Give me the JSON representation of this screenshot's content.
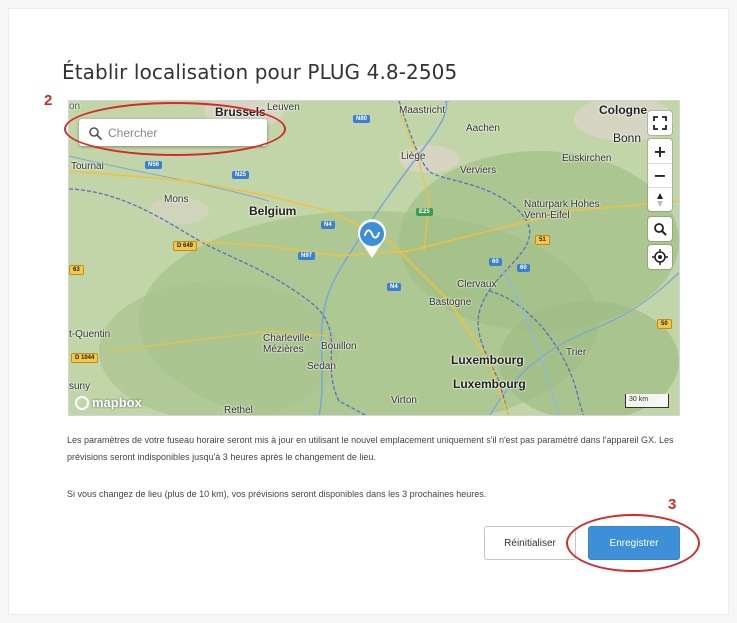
{
  "dialog": {
    "title": "Établir localisation pour PLUG 4.8-2505"
  },
  "map": {
    "search_placeholder": "Chercher",
    "controls": {
      "fullscreen": "fullscreen-icon",
      "zoom_in": "+",
      "zoom_out": "−",
      "compass": "compass-icon",
      "search": "search-zoom-icon",
      "locate": "locate-icon"
    },
    "labels": {
      "brussels": "Brussels",
      "leuven": "Leuven",
      "maastricht": "Maastricht",
      "aachen": "Aachen",
      "cologne": "Cologne",
      "bonn": "Bonn",
      "tournai": "Tournai",
      "liege": "Liège",
      "verviers": "Verviers",
      "euskirchen": "Euskirchen",
      "mons": "Mons",
      "belgium": "Belgium",
      "naturpark": "Naturpark Hohes\nVenn-Eifel",
      "bastogne": "Bastogne",
      "clervaux": "Clervaux",
      "st_quentin": "t-Quentin",
      "charleville": "Charleville-\nMézières",
      "bouillon": "Bouillon",
      "sedan": "Sedan",
      "luxembourg_country": "Luxembourg",
      "luxembourg_city": "Luxembourg",
      "trier": "Trier",
      "rethel": "Rethel",
      "virton": "Virton",
      "suny": "suny",
      "on": "on"
    },
    "shields": {
      "n80": "N80",
      "n56": "N56",
      "n25": "N25",
      "n4a": "N4",
      "n97": "N97",
      "n4b": "N4",
      "d649": "D 649",
      "e25": "E25",
      "r51": "51",
      "r60a": "60",
      "r60b": "60",
      "r63": "63",
      "r50": "50",
      "d1044": "D 1044"
    },
    "logo": "mapbox",
    "scale": "30 km",
    "water_color": "#6a9fd8",
    "border_color": "#5b6fbf"
  },
  "info": {
    "paragraph1": "Les paramètres de votre fuseau horaire seront mis à jour en utilisant le nouvel emplacement uniquement s'il n'est pas paramétré dans l'appareil GX. Les prévisions seront indisponibles jusqu'à 3 heures après le changement de lieu.",
    "paragraph2": "Si vous changez de lieu (plus de 10 km), vos prévisions seront disponibles dans les 3 prochaines heures."
  },
  "buttons": {
    "reset": "Réinitialiser",
    "save": "Enregistrer"
  },
  "annotations": {
    "step2": "2",
    "step3": "3",
    "color": "#d42a2a"
  }
}
